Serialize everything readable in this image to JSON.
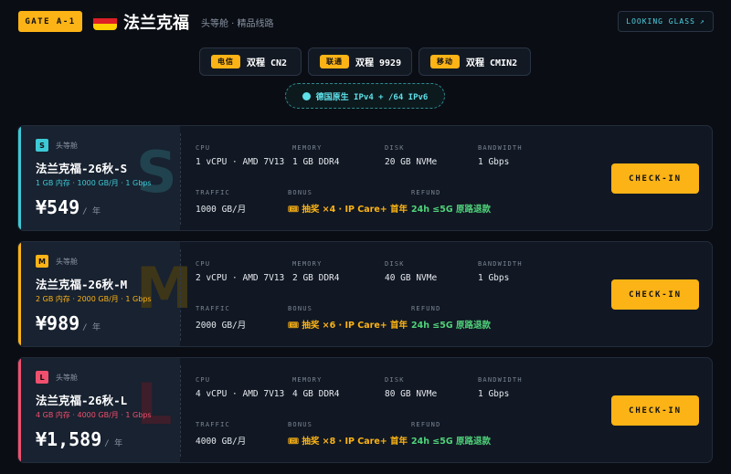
{
  "header": {
    "gate": "GATE A-1",
    "title": "法兰克福",
    "subtitle": "头等舱 · 精品线路",
    "looking_glass": "LOOKING GLASS",
    "looking_glass_icon": "arrow-up-right-icon"
  },
  "isps": [
    {
      "tag": "电信",
      "value": "双程 CN2"
    },
    {
      "tag": "联通",
      "value": "双程 9929"
    },
    {
      "tag": "移动",
      "value": "双程 CMIN2"
    }
  ],
  "ip_pill": "德国原生 IPv4 + /64 IPv6",
  "spec_labels": {
    "cpu": "CPU",
    "memory": "MEMORY",
    "disk": "DISK",
    "bandwidth": "BANDWIDTH",
    "traffic": "TRAFFIC",
    "bonus": "BONUS",
    "refund": "REFUND"
  },
  "checkin_label": "CHECK-IN",
  "plans": [
    {
      "badge": "S",
      "tier": "头等舱",
      "name": "法兰克福-26秋-S",
      "summary": "1 GB 内存 · 1000 GB/月 · 1 Gbps",
      "price": "¥549",
      "per": "/ 年",
      "cpu": "1 vCPU · AMD 7V13",
      "memory": "1 GB DDR4",
      "disk": "20 GB NVMe",
      "bandwidth": "1 Gbps",
      "traffic": "1000 GB/月",
      "bonus": "🎟 抽奖 ×4 · IP Care+ 首年",
      "refund": "24h ≤5G 原路退款",
      "accent": "#3ec9d6"
    },
    {
      "badge": "M",
      "tier": "头等舱",
      "name": "法兰克福-26秋-M",
      "summary": "2 GB 内存 · 2000 GB/月 · 1 Gbps",
      "price": "¥989",
      "per": "/ 年",
      "cpu": "2 vCPU · AMD 7V13",
      "memory": "2 GB DDR4",
      "disk": "40 GB NVMe",
      "bandwidth": "1 Gbps",
      "traffic": "2000 GB/月",
      "bonus": "🎟 抽奖 ×6 · IP Care+ 首年",
      "refund": "24h ≤5G 原路退款",
      "accent": "#fcb316"
    },
    {
      "badge": "L",
      "tier": "头等舱",
      "name": "法兰克福-26秋-L",
      "summary": "4 GB 内存 · 4000 GB/月 · 1 Gbps",
      "price": "¥1,589",
      "per": "/ 年",
      "cpu": "4 vCPU · AMD 7V13",
      "memory": "4 GB DDR4",
      "disk": "80 GB NVMe",
      "bandwidth": "1 Gbps",
      "traffic": "4000 GB/月",
      "bonus": "🎟 抽奖 ×8 · IP Care+ 首年",
      "refund": "24h ≤5G 原路退款",
      "accent": "#f0506e"
    }
  ]
}
